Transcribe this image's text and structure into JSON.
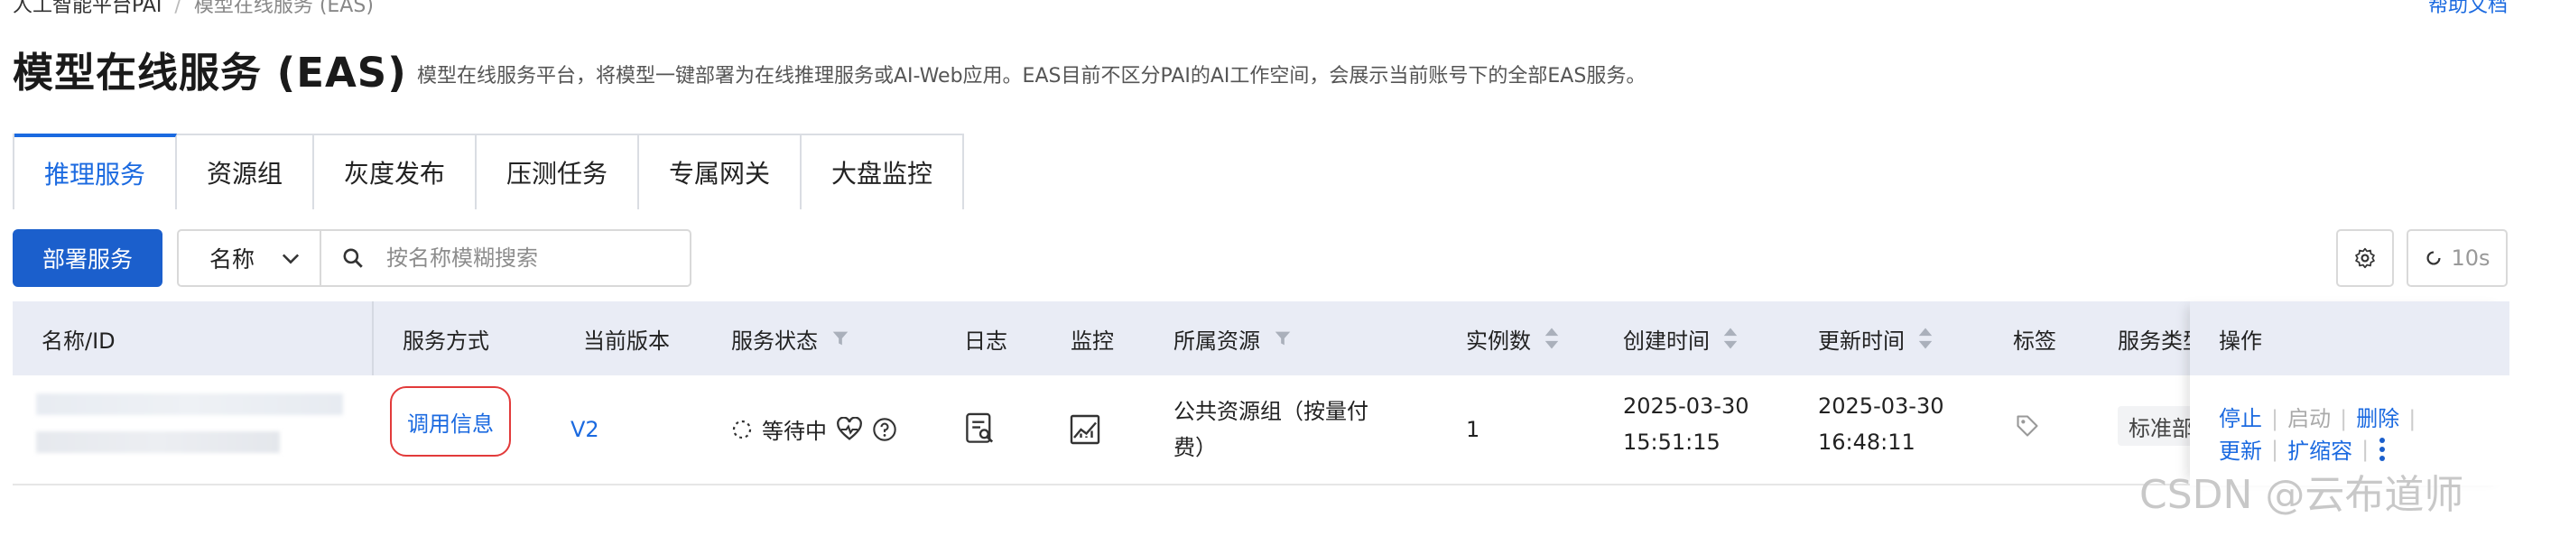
{
  "breadcrumb": {
    "root": "人工智能平台PAI",
    "current": "模型在线服务 (EAS)"
  },
  "help_link": "帮助文档",
  "page": {
    "title": "模型在线服务 (EAS)",
    "subtitle": "模型在线服务平台，将模型一键部署为在线推理服务或AI-Web应用。EAS目前不区分PAI的AI工作空间，会展示当前账号下的全部EAS服务。"
  },
  "tabs": [
    {
      "label": "推理服务",
      "active": true
    },
    {
      "label": "资源组"
    },
    {
      "label": "灰度发布"
    },
    {
      "label": "压测任务"
    },
    {
      "label": "专属网关"
    },
    {
      "label": "大盘监控"
    }
  ],
  "toolbar": {
    "deploy_label": "部署服务",
    "filter_field": "名称",
    "search_placeholder": "按名称模糊搜索",
    "refresh_label": "10s"
  },
  "table": {
    "columns": [
      "名称/ID",
      "服务方式",
      "当前版本",
      "服务状态",
      "日志",
      "监控",
      "所属资源",
      "实例数",
      "创建时间",
      "更新时间",
      "标签",
      "服务类型",
      "操作"
    ],
    "rows": [
      {
        "call_info": "调用信息",
        "version": "V2",
        "status": "等待中",
        "resource_line1": "公共资源组（按量付",
        "resource_line2": "费）",
        "instances": "1",
        "created_date": "2025-03-30",
        "created_time": "15:51:15",
        "updated_date": "2025-03-30",
        "updated_time": "16:48:11",
        "service_type": "标准部署",
        "actions": {
          "stop": "停止",
          "start": "启动",
          "delete": "删除",
          "update": "更新",
          "scale": "扩缩容"
        }
      }
    ]
  },
  "watermark": "CSDN @云布道师",
  "colors": {
    "accent": "#1b6ae0",
    "primary_button": "#1b5fcc",
    "header_bg": "#e9ecf5",
    "highlight_box": "#e23a3a"
  }
}
